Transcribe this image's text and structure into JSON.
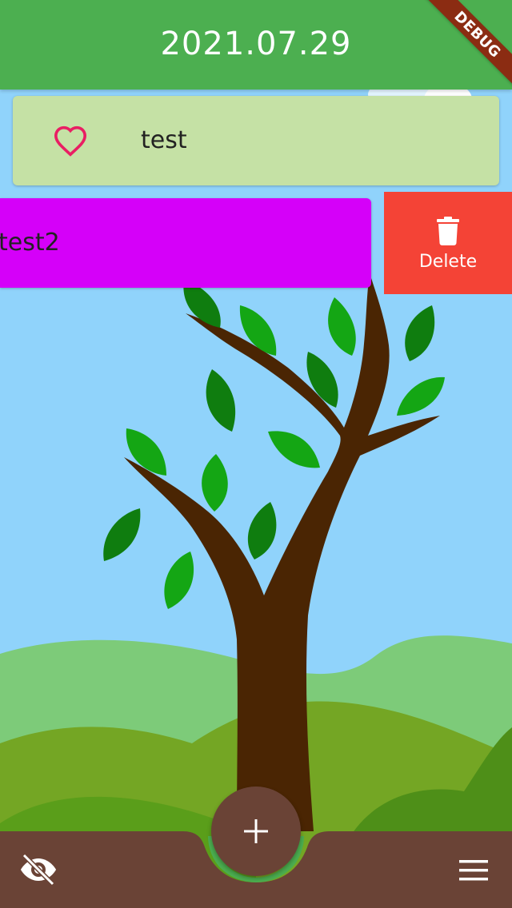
{
  "app_bar": {
    "title": "2021.07.29"
  },
  "debug_banner": {
    "label": "DEBUG"
  },
  "list": {
    "items": [
      {
        "label": "test",
        "icon": "heart-outline-icon",
        "background_color": "#C5E1A5",
        "icon_color": "#E91E63"
      },
      {
        "label": "test2",
        "background_color": "#D500F9",
        "swipe_action": {
          "label": "Delete",
          "icon": "trash-icon",
          "background_color": "#F44336"
        }
      }
    ]
  },
  "bottom_bar": {
    "left_icon": "eye-off-icon",
    "right_icon": "menu-icon",
    "fab_icon": "plus-icon",
    "color": "#6A4336",
    "fab_ring_color": "#4CAF50"
  },
  "colors": {
    "app_bar": "#4CAF50",
    "sky": "#90D3FB",
    "trunk": "#4A2503"
  }
}
